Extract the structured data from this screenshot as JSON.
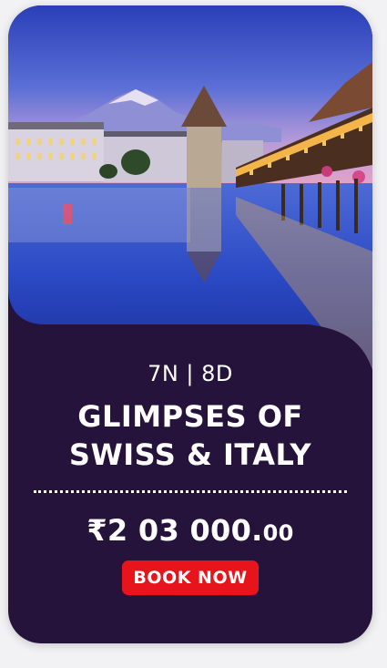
{
  "package": {
    "duration": "7N | 8D",
    "title_line1": "GLIMPSES OF",
    "title_line2": "SWISS & ITALY",
    "price_main": "₹2 03 000.",
    "price_paise": "00",
    "book_label": "BOOK NOW"
  },
  "colors": {
    "card_bg": "#25133b",
    "button_bg": "#e8141b"
  },
  "image": {
    "icon": "lucerne-chapel-bridge-photo"
  }
}
